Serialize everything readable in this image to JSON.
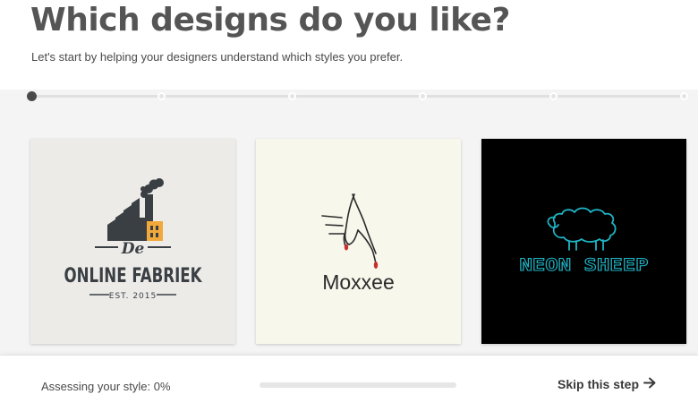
{
  "header": {
    "title": "Which designs do you like?",
    "subtitle": "Let's start by helping your designers understand which styles you prefer."
  },
  "stepper": {
    "total_steps": 6,
    "current_step": 1
  },
  "designs": [
    {
      "name": "De Online Fabriek",
      "line1": "De",
      "line2": "ONLINE FABRIEK",
      "tagline": "EST. 2015",
      "accent": "#f2a93b",
      "ink": "#3a3f44",
      "background": "#ecebe8"
    },
    {
      "name": "Moxxee",
      "wordmark": "Moxxee",
      "accent": "#c8302e",
      "ink": "#2b2b2b",
      "background": "#f8f7ec"
    },
    {
      "name": "Neon Sheep",
      "wordmark": "NEON SHEEP",
      "accent": "#1fb5c6",
      "background": "#000000"
    }
  ],
  "footer": {
    "assessing_label": "Assessing your style: 0%",
    "progress": 0,
    "skip_label": "Skip this step",
    "skip_icon": "arrow-right-icon"
  },
  "colors": {
    "title": "#555555",
    "progress_fill": "#3aa0d2"
  }
}
